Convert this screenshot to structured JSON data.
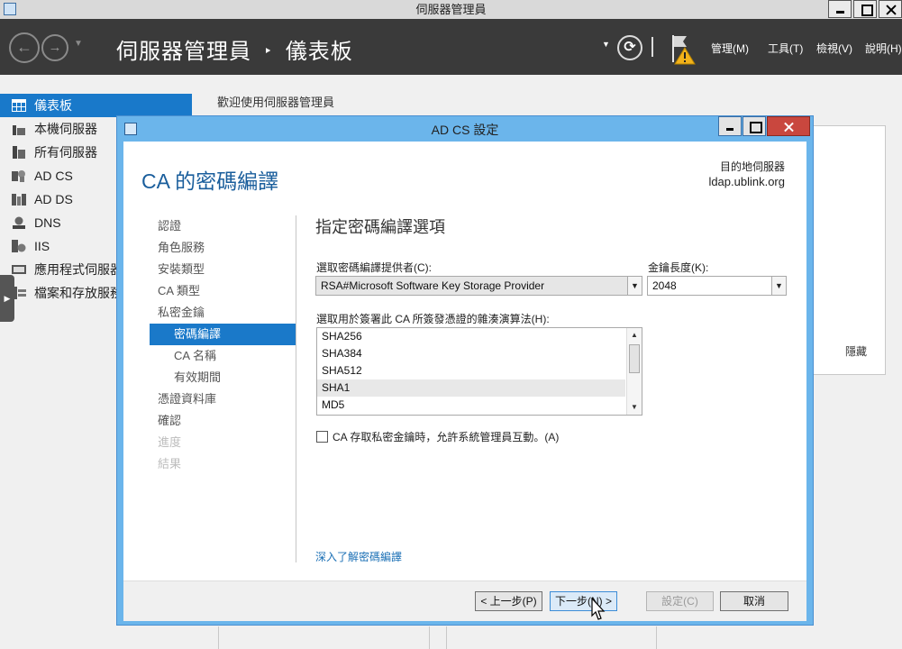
{
  "window": {
    "title": "伺服器管理員"
  },
  "header": {
    "breadcrumb_app": "伺服器管理員",
    "breadcrumb_sep": "‣",
    "breadcrumb_page": "儀表板",
    "menus": [
      "管理(M)",
      "工具(T)",
      "檢視(V)",
      "說明(H)"
    ]
  },
  "sidebar": {
    "items": [
      {
        "label": "儀表板",
        "icon": "dashboard-icon"
      },
      {
        "label": "本機伺服器",
        "icon": "server-icon"
      },
      {
        "label": "所有伺服器",
        "icon": "servers-icon"
      },
      {
        "label": "AD CS",
        "icon": "ad-cs-icon"
      },
      {
        "label": "AD DS",
        "icon": "ad-ds-icon"
      },
      {
        "label": "DNS",
        "icon": "dns-icon"
      },
      {
        "label": "IIS",
        "icon": "iis-icon"
      },
      {
        "label": "應用程式伺服器",
        "icon": "app-server-icon"
      },
      {
        "label": "檔案和存放服務",
        "icon": "file-storage-icon"
      }
    ]
  },
  "main": {
    "welcome": "歡迎使用伺服器管理員",
    "hide": "隱藏"
  },
  "dialog": {
    "title": "AD CS 設定",
    "heading": "CA 的密碼編譯",
    "destination_label": "目的地伺服器",
    "destination_value": "ldap.ublink.org",
    "steps": [
      {
        "label": "認證",
        "state": "normal"
      },
      {
        "label": "角色服務",
        "state": "normal"
      },
      {
        "label": "安裝類型",
        "state": "normal"
      },
      {
        "label": "CA 類型",
        "state": "normal"
      },
      {
        "label": "私密金鑰",
        "state": "normal"
      },
      {
        "label": "密碼編譯",
        "state": "active"
      },
      {
        "label": "CA 名稱",
        "state": "sub"
      },
      {
        "label": "有效期間",
        "state": "sub"
      },
      {
        "label": "憑證資料庫",
        "state": "normal"
      },
      {
        "label": "確認",
        "state": "normal"
      },
      {
        "label": "進度",
        "state": "disabled"
      },
      {
        "label": "結果",
        "state": "disabled"
      }
    ],
    "section_title": "指定密碼編譯選項",
    "provider_label": "選取密碼編譯提供者(C):",
    "provider_value": "RSA#Microsoft Software Key Storage Provider",
    "key_length_label": "金鑰長度(K):",
    "key_length_value": "2048",
    "hash_label": "選取用於簽署此 CA 所簽發憑證的雜湊演算法(H):",
    "hash_options": [
      "SHA256",
      "SHA384",
      "SHA512",
      "SHA1",
      "MD5"
    ],
    "hash_selected": "SHA1",
    "allow_interaction_label": "CA 存取私密金鑰時，允許系統管理員互動。(A)",
    "allow_interaction_checked": false,
    "learn_more": "深入了解密碼編譯",
    "buttons": {
      "prev": "< 上一步(P)",
      "next": "下一步(N) >",
      "configure": "設定(C)",
      "cancel": "取消"
    }
  },
  "colors": {
    "accent": "#1979ca",
    "header_bg": "#3a3a3a",
    "dialog_frame": "#6bb5eb",
    "heading": "#1a5e9c",
    "close_red": "#c9473e"
  }
}
